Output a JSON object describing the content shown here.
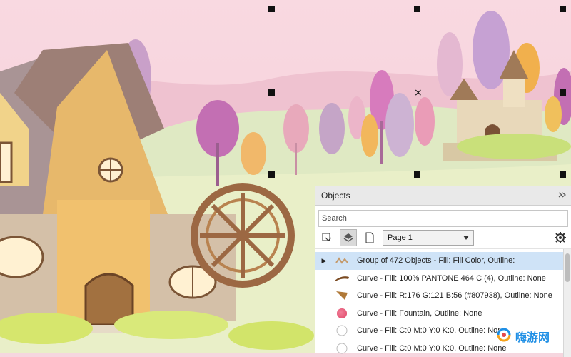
{
  "canvas": {
    "description_colors": {
      "sky": "#f6d6df",
      "hill": "#d9e7b9",
      "accent": "#c36fb3"
    }
  },
  "objects_panel": {
    "title": "Objects",
    "search_placeholder": "Search",
    "page_selector": {
      "selected": "Page 1"
    },
    "items": [
      {
        "label": "Group of 472 Objects - Fill: Fill Color, Outline:",
        "selected": true,
        "expandable": true,
        "thumb": "group-thumb"
      },
      {
        "label": "Curve - Fill: 100% PANTONE 464 C (4), Outline: None",
        "selected": false,
        "thumb": "brown-curve-thumb"
      },
      {
        "label": "Curve - Fill: R:176 G:121 B:56 (#807938), Outline: None",
        "selected": false,
        "thumb": "tan-shape-thumb"
      },
      {
        "label": "Curve - Fill: Fountain, Outline: None",
        "selected": false,
        "thumb": "pink-circle-thumb"
      },
      {
        "label": "Curve - Fill: C:0 M:0 Y:0 K:0, Outline: None",
        "selected": false,
        "thumb": "white-circle-thumb"
      },
      {
        "label": "Curve - Fill: C:0 M:0 Y:0 K:0, Outline: None",
        "selected": false,
        "thumb": "white-circle-thumb"
      }
    ]
  },
  "watermark": {
    "text": "嗨游网"
  }
}
